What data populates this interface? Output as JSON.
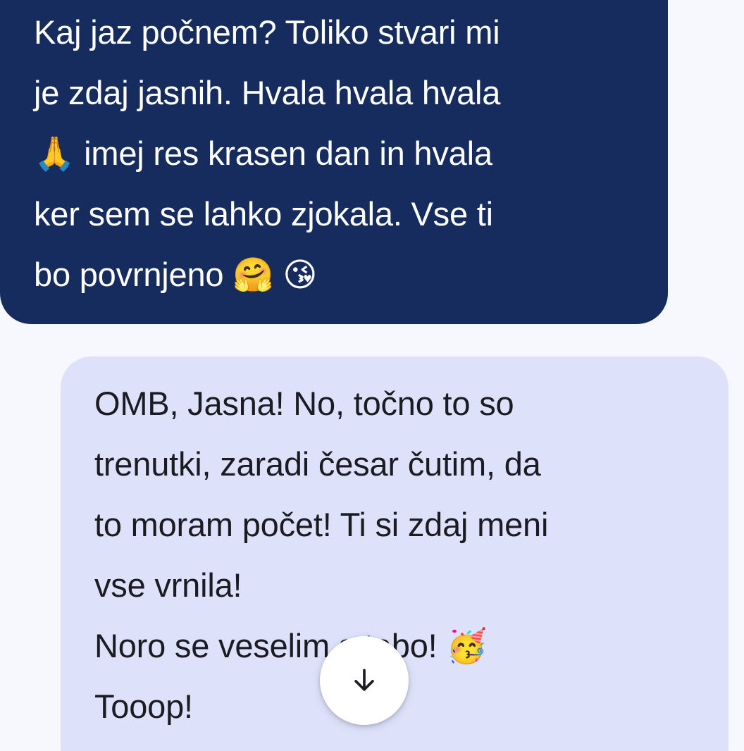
{
  "messages": [
    {
      "role": "sent",
      "text": "Kaj jaz počnem? Toliko stvari mi\nje zdaj jasnih. Hvala hvala hvala\n🙏 imej res krasen dan in hvala\nker sem se lahko zjokala. Vse ti\nbo povrnjeno 🤗 😘"
    },
    {
      "role": "received",
      "text": "OMB, Jasna! No, točno to so\ntrenutki, zaradi česar čutim, da\nto moram počet! Ti si zdaj meni\nvse vrnila!\nNoro se veselim s tabo! 🥳\nTooop!"
    }
  ],
  "scroll_button": {
    "icon": "arrow-down-icon"
  },
  "colors": {
    "background": "#f7f8fd",
    "sent_bubble": "#172c5e",
    "received_bubble": "#dde2fa",
    "sent_text": "#ffffff",
    "received_text": "#1b1c22"
  }
}
